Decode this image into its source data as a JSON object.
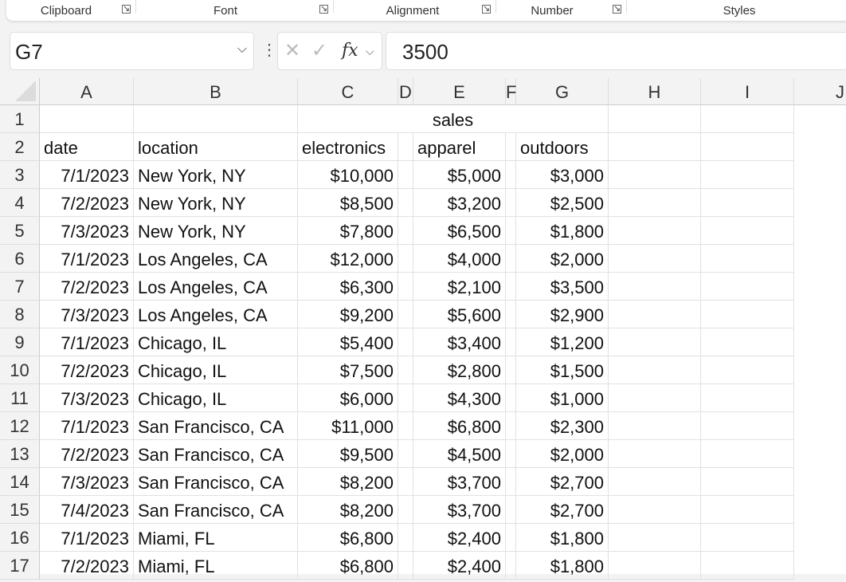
{
  "ribbon": {
    "groups": [
      "Clipboard",
      "Font",
      "Alignment",
      "Number",
      "Styles"
    ]
  },
  "formula_bar": {
    "name_box": "G7",
    "value": "3500",
    "fx_label": "fx",
    "cancel": "✕",
    "enter": "✓"
  },
  "columns": [
    "A",
    "B",
    "C",
    "D",
    "E",
    "F",
    "G",
    "H",
    "I",
    "J"
  ],
  "rows": [
    {
      "n": "1",
      "cells": [
        "",
        "",
        "sales",
        "",
        "",
        ""
      ]
    },
    {
      "n": "2",
      "cells": [
        "date",
        "location",
        "electronics",
        "apparel",
        "outdoors"
      ]
    },
    {
      "n": "3",
      "cells": [
        "7/1/2023",
        "New York, NY",
        "$10,000",
        "$5,000",
        "$3,000"
      ]
    },
    {
      "n": "4",
      "cells": [
        "7/2/2023",
        "New York, NY",
        "$8,500",
        "$3,200",
        "$2,500"
      ]
    },
    {
      "n": "5",
      "cells": [
        "7/3/2023",
        "New York, NY",
        "$7,800",
        "$6,500",
        "$1,800"
      ]
    },
    {
      "n": "6",
      "cells": [
        "7/1/2023",
        "Los Angeles, CA",
        "$12,000",
        "$4,000",
        "$2,000"
      ]
    },
    {
      "n": "7",
      "cells": [
        "7/2/2023",
        "Los Angeles, CA",
        "$6,300",
        "$2,100",
        "$3,500"
      ]
    },
    {
      "n": "8",
      "cells": [
        "7/3/2023",
        "Los Angeles, CA",
        "$9,200",
        "$5,600",
        "$2,900"
      ]
    },
    {
      "n": "9",
      "cells": [
        "7/1/2023",
        "Chicago, IL",
        "$5,400",
        "$3,400",
        "$1,200"
      ]
    },
    {
      "n": "10",
      "cells": [
        "7/2/2023",
        "Chicago, IL",
        "$7,500",
        "$2,800",
        "$1,500"
      ]
    },
    {
      "n": "11",
      "cells": [
        "7/3/2023",
        "Chicago, IL",
        "$6,000",
        "$4,300",
        "$1,000"
      ]
    },
    {
      "n": "12",
      "cells": [
        "7/1/2023",
        "San Francisco, CA",
        "$11,000",
        "$6,800",
        "$2,300"
      ]
    },
    {
      "n": "13",
      "cells": [
        "7/2/2023",
        "San Francisco, CA",
        "$9,500",
        "$4,500",
        "$2,000"
      ]
    },
    {
      "n": "14",
      "cells": [
        "7/3/2023",
        "San Francisco, CA",
        "$8,200",
        "$3,700",
        "$2,700"
      ]
    },
    {
      "n": "15",
      "cells": [
        "7/4/2023",
        "San Francisco, CA",
        "$8,200",
        "$3,700",
        "$2,700"
      ]
    },
    {
      "n": "16",
      "cells": [
        "7/1/2023",
        "Miami, FL",
        "$6,800",
        "$2,400",
        "$1,800"
      ]
    },
    {
      "n": "17",
      "cells": [
        "7/2/2023",
        "Miami, FL",
        "$6,800",
        "$2,400",
        "$1,800"
      ]
    }
  ]
}
